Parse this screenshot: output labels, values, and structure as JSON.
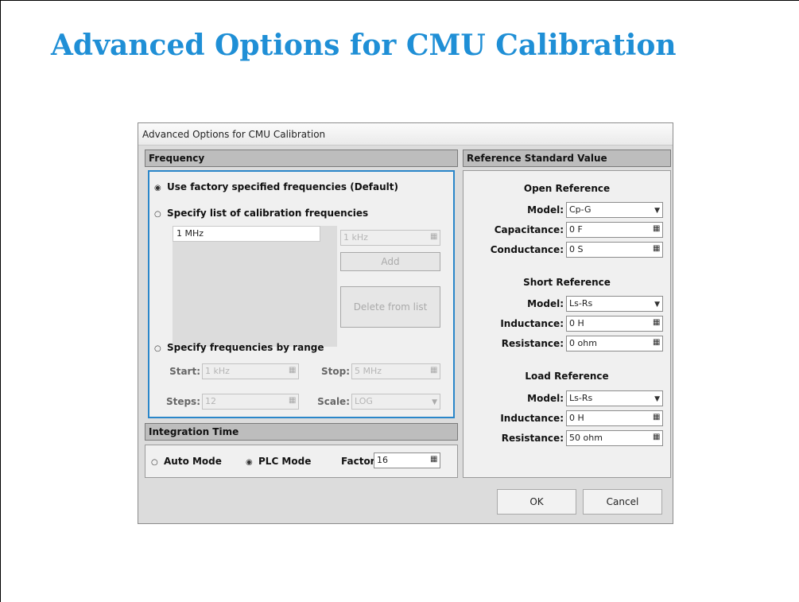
{
  "slide": {
    "title": "Advanced Options for CMU Calibration"
  },
  "dialog": {
    "title": "Advanced Options for CMU Calibration",
    "frequency": {
      "header": "Frequency",
      "option_default": "Use factory specified frequencies (Default)",
      "option_list": "Specify list of calibration frequencies",
      "option_range": "Specify frequencies by range",
      "selected": "option_default",
      "list_items": [
        "1 MHz"
      ],
      "add_value": "1 kHz",
      "add_button": "Add",
      "delete_button": "Delete from list",
      "start_label": "Start:",
      "start_value": "1 kHz",
      "stop_label": "Stop:",
      "stop_value": "5 MHz",
      "steps_label": "Steps:",
      "steps_value": "12",
      "scale_label": "Scale:",
      "scale_value": "LOG"
    },
    "integration": {
      "header": "Integration Time",
      "auto_label": "Auto Mode",
      "plc_label": "PLC Mode",
      "selected": "plc",
      "factor_label": "Factor:",
      "factor_value": "16"
    },
    "reference": {
      "header": "Reference Standard Value",
      "open": {
        "title": "Open Reference",
        "model_label": "Model:",
        "model_value": "Cp-G",
        "cap_label": "Capacitance:",
        "cap_value": "0 F",
        "cond_label": "Conductance:",
        "cond_value": "0 S"
      },
      "short": {
        "title": "Short Reference",
        "model_label": "Model:",
        "model_value": "Ls-Rs",
        "ind_label": "Inductance:",
        "ind_value": "0 H",
        "res_label": "Resistance:",
        "res_value": "0 ohm"
      },
      "load": {
        "title": "Load Reference",
        "model_label": "Model:",
        "model_value": "Ls-Rs",
        "ind_label": "Inductance:",
        "ind_value": "0 H",
        "res_label": "Resistance:",
        "res_value": "50 ohm"
      }
    },
    "buttons": {
      "ok": "OK",
      "cancel": "Cancel"
    },
    "glyphs": {
      "radio_on": "◉",
      "radio_off": "○",
      "calc": "▦",
      "drop": "▼"
    }
  }
}
